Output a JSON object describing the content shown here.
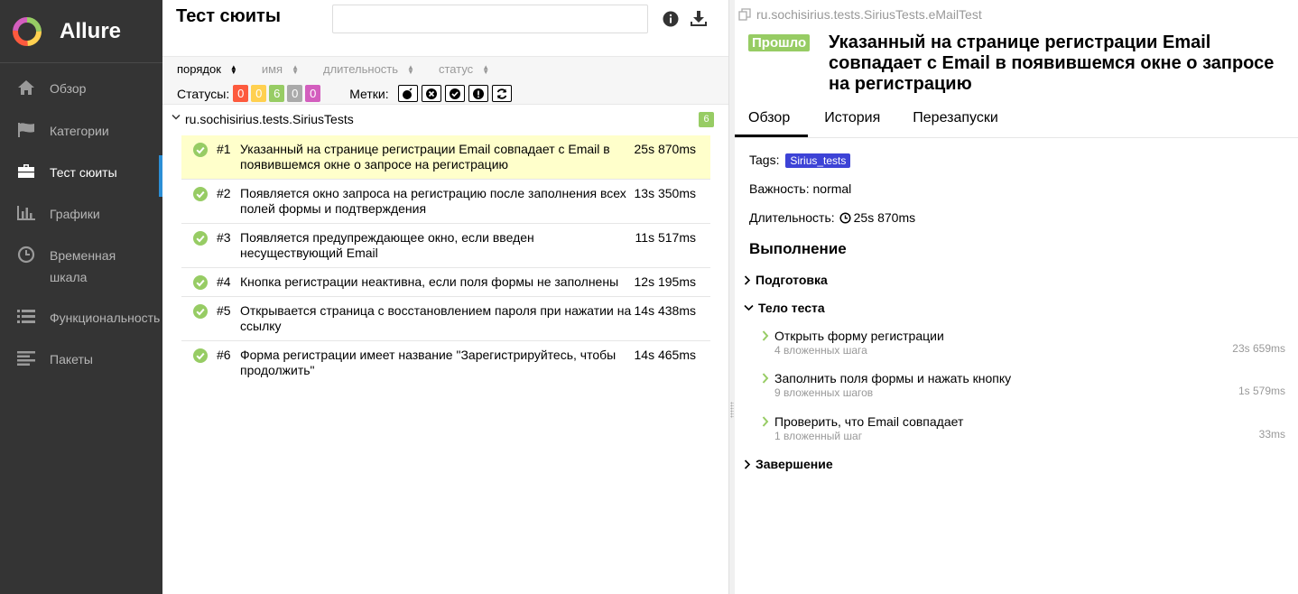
{
  "app": {
    "name": "Allure"
  },
  "sidebar": {
    "items": [
      {
        "label": "Обзор",
        "icon": "home-icon"
      },
      {
        "label": "Категории",
        "icon": "flag-icon"
      },
      {
        "label": "Тест сюиты",
        "icon": "briefcase-icon",
        "active": true
      },
      {
        "label": "Графики",
        "icon": "bar-chart-icon"
      },
      {
        "label": "Временная шкала",
        "icon": "clock-icon"
      },
      {
        "label": "Функциональность",
        "icon": "list-icon"
      },
      {
        "label": "Пакеты",
        "icon": "align-left-icon"
      }
    ]
  },
  "suites": {
    "title": "Тест сюиты",
    "search_value": "",
    "sort": [
      "порядок",
      "имя",
      "длительность",
      "статус"
    ],
    "statuses_label": "Статусы:",
    "statuses": [
      {
        "count": "0",
        "color": "#fd5a3e"
      },
      {
        "count": "0",
        "color": "#ffd050"
      },
      {
        "count": "6",
        "color": "#97cc64"
      },
      {
        "count": "0",
        "color": "#aaaaaa"
      },
      {
        "count": "0",
        "color": "#d35ebe"
      }
    ],
    "marks_label": "Метки:",
    "group": {
      "name": "ru.sochisirius.tests.SiriusTests",
      "count": "6"
    },
    "tests": [
      {
        "num": "#1",
        "name": "Указанный на странице регистрации Email совпадает с Email в появившемся окне о запросе на регистрацию",
        "duration": "25s 870ms"
      },
      {
        "num": "#2",
        "name": "Появляется окно запроса на регистрацию после заполнения всех полей формы и подтверждения",
        "duration": "13s 350ms"
      },
      {
        "num": "#3",
        "name": "Появляется предупреждающее окно, если введен несуществующий Email",
        "duration": "11s 517ms"
      },
      {
        "num": "#4",
        "name": "Кнопка регистрации неактивна, если поля формы не заполнены",
        "duration": "12s 195ms"
      },
      {
        "num": "#5",
        "name": "Открывается страница с восстановлением пароля при нажатии на ссылку",
        "duration": "14s 438ms"
      },
      {
        "num": "#6",
        "name": "Форма регистрации имеет название \"Зарегистрируйтесь, чтобы продолжить\"",
        "duration": "14s 465ms"
      }
    ]
  },
  "detail": {
    "breadcrumb": "ru.sochisirius.tests.SiriusTests.eMailTest",
    "status": "Прошло",
    "title": "Указанный на странице регистрации Email совпадает с Email в появившемся окне о запросе на регистрацию",
    "tabs": [
      "Обзор",
      "История",
      "Перезапуски"
    ],
    "tags_label": "Tags:",
    "tag": "Sirius_tests",
    "severity": "Важность: normal",
    "duration_label": "Длительность:",
    "duration": "25s 870ms",
    "execution_title": "Выполнение",
    "setup": "Подготовка",
    "body": "Тело теста",
    "teardown": "Завершение",
    "steps": [
      {
        "name": "Открыть форму регистрации",
        "sub": "4 вложенных шага",
        "duration": "23s 659ms"
      },
      {
        "name": "Заполнить поля формы и нажать кнопку",
        "sub": "9 вложенных шагов",
        "duration": "1s 579ms"
      },
      {
        "name": "Проверить, что Email совпадает",
        "sub": "1 вложенный шаг",
        "duration": "33ms"
      }
    ]
  }
}
